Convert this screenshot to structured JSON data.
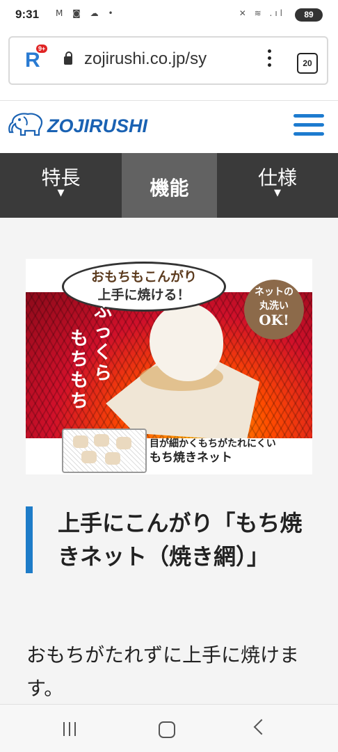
{
  "status_bar": {
    "time": "9:31",
    "notifications": "M ◙ ☁ •",
    "system": "✕ ≋ .ıl",
    "battery": "89"
  },
  "browser": {
    "app_badge": "9+",
    "url": "zojirushi.co.jp/sy",
    "tab_count": "20"
  },
  "site": {
    "logo_text": "ZOJIRUSHI",
    "tabs": [
      {
        "label": "特長",
        "arrow": "▼",
        "active": false
      },
      {
        "label": "機能",
        "arrow": "",
        "active": true
      },
      {
        "label": "仕様",
        "arrow": "▼",
        "active": false
      }
    ]
  },
  "hero": {
    "bubble_line1": "おもちもこんがり",
    "bubble_line2": "上手に焼ける！",
    "vertical_col1": "ふっくら",
    "vertical_col2": "もちもち",
    "circle_line1": "ネットの",
    "circle_line2": "丸洗い",
    "circle_line3": "OK!",
    "caption_line1": "目が細かくもちがたれにくい",
    "caption_line2": "もち焼きネット"
  },
  "content": {
    "heading": "上手にこんがり「もち焼きネット（焼き網）」",
    "body": "おもちがたれずに上手に焼けます。"
  },
  "colors": {
    "accent_blue": "#1e7cc8",
    "nav_dark": "#3a3a3a",
    "nav_active": "#626262",
    "hero_red": "#c8102e"
  }
}
